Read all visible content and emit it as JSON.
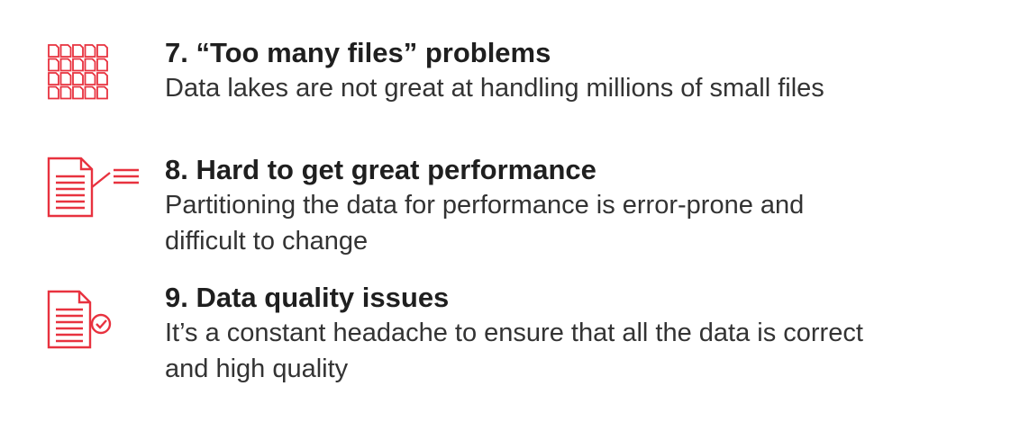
{
  "colors": {
    "accent": "#e8323f",
    "title": "#1f1f1f",
    "body": "#333333"
  },
  "items": [
    {
      "icon": "file-grid-icon",
      "title": "7. “Too many files” problems",
      "description_lines": [
        "Data lakes are not great at handling millions of small files"
      ]
    },
    {
      "icon": "document-lines-icon",
      "title": "8. Hard to get great performance",
      "description_lines": [
        "Partitioning the data for performance is error-prone and",
        "difficult to change"
      ]
    },
    {
      "icon": "document-check-icon",
      "title": "9. Data quality issues",
      "description_lines": [
        "It’s a constant headache to ensure that all the data is correct",
        "and high quality"
      ]
    }
  ]
}
